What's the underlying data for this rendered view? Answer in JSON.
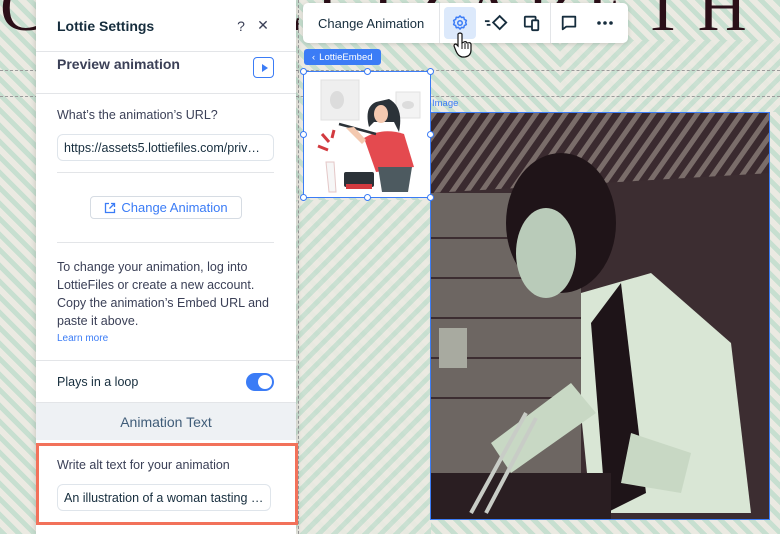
{
  "background": {
    "headline_text": "CHEF ELIZABETH"
  },
  "panel": {
    "title": "Lottie Settings",
    "help_icon": "question-icon",
    "close_icon": "close-icon",
    "preview_label": "Preview animation",
    "url_label": "What’s the animation’s URL?",
    "url_value": "https://assets5.lottiefiles.com/priv…",
    "change_button_label": "Change Animation",
    "help_text": "To change your animation, log into LottieFiles or create a new account. Copy the animation’s Embed URL and paste it above.",
    "learn_more": "Learn more",
    "loop_label": "Plays in a loop",
    "loop_enabled": true,
    "section_header": "Animation Text",
    "alt_label": "Write alt text for your animation",
    "alt_value": "An illustration of a woman tasting …"
  },
  "toolbar": {
    "change_animation": "Change Animation",
    "buttons": [
      "settings-icon",
      "animation-icon",
      "layout-devices-icon",
      "comment-icon",
      "more-icon"
    ],
    "active": "settings-icon"
  },
  "canvas": {
    "lottie_tag": "LottieEmbed",
    "image_label": "Image"
  },
  "colors": {
    "accent": "#3b7cf6",
    "highlight": "#f2715a",
    "headline": "#2b0f18"
  }
}
